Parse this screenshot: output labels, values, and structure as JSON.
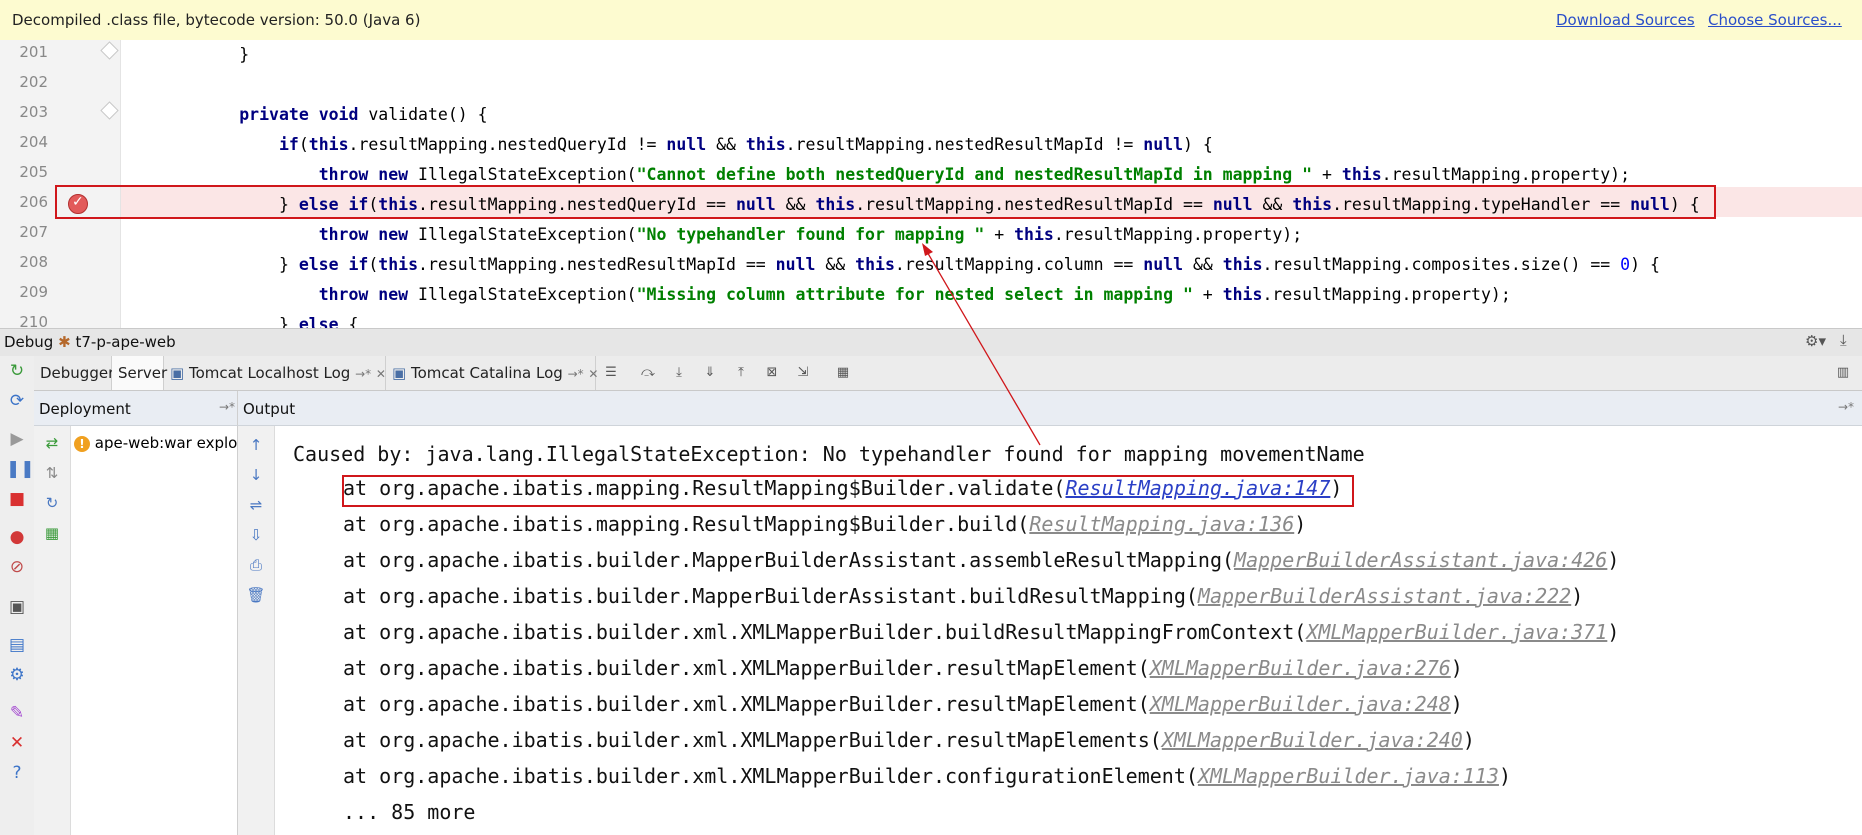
{
  "banner": {
    "message": "Decompiled .class file, bytecode version: 50.0 (Java 6)",
    "download_sources": "Download Sources",
    "choose_sources": "Choose Sources..."
  },
  "editor": {
    "line_numbers": [
      "201",
      "202",
      "203",
      "204",
      "205",
      "206",
      "207",
      "208",
      "209",
      "210"
    ],
    "breakpoint_line": "206"
  },
  "debug": {
    "title": "Debug",
    "config_name": "t7-p-ape-web"
  },
  "tabs": {
    "debugger": "Debugger",
    "server": "Server",
    "localhost_log": "Tomcat Localhost Log",
    "catalina_log": "Tomcat Catalina Log",
    "pin": "→*",
    "close": "✕"
  },
  "deployment": {
    "title": "Deployment",
    "item": "ape-web:war explo"
  },
  "output": {
    "title": "Output",
    "caused_by": "Caused by: java.lang.IllegalStateException: No typehandler found for mapping movementName",
    "frames": [
      {
        "text": "at org.apache.ibatis.mapping.ResultMapping$Builder.validate(",
        "link": "ResultMapping.java:147",
        "end": ")"
      },
      {
        "text": "at org.apache.ibatis.mapping.ResultMapping$Builder.build(",
        "link": "ResultMapping.java:136",
        "end": ")"
      },
      {
        "text": "at org.apache.ibatis.builder.MapperBuilderAssistant.assembleResultMapping(",
        "link": "MapperBuilderAssistant.java:426",
        "end": ")"
      },
      {
        "text": "at org.apache.ibatis.builder.MapperBuilderAssistant.buildResultMapping(",
        "link": "MapperBuilderAssistant.java:222",
        "end": ")"
      },
      {
        "text": "at org.apache.ibatis.builder.xml.XMLMapperBuilder.buildResultMappingFromContext(",
        "link": "XMLMapperBuilder.java:371",
        "end": ")"
      },
      {
        "text": "at org.apache.ibatis.builder.xml.XMLMapperBuilder.resultMapElement(",
        "link": "XMLMapperBuilder.java:276",
        "end": ")"
      },
      {
        "text": "at org.apache.ibatis.builder.xml.XMLMapperBuilder.resultMapElement(",
        "link": "XMLMapperBuilder.java:248",
        "end": ")"
      },
      {
        "text": "at org.apache.ibatis.builder.xml.XMLMapperBuilder.resultMapElements(",
        "link": "XMLMapperBuilder.java:240",
        "end": ")"
      },
      {
        "text": "at org.apache.ibatis.builder.xml.XMLMapperBuilder.configurationElement(",
        "link": "XMLMapperBuilder.java:113",
        "end": ")"
      }
    ],
    "more": "... 85 more"
  },
  "colors": {
    "breakpoint_red": "#d0171b",
    "keyword": "#000080",
    "string": "#008000",
    "field": "#660e7a",
    "link_active": "#2a3fc6"
  }
}
